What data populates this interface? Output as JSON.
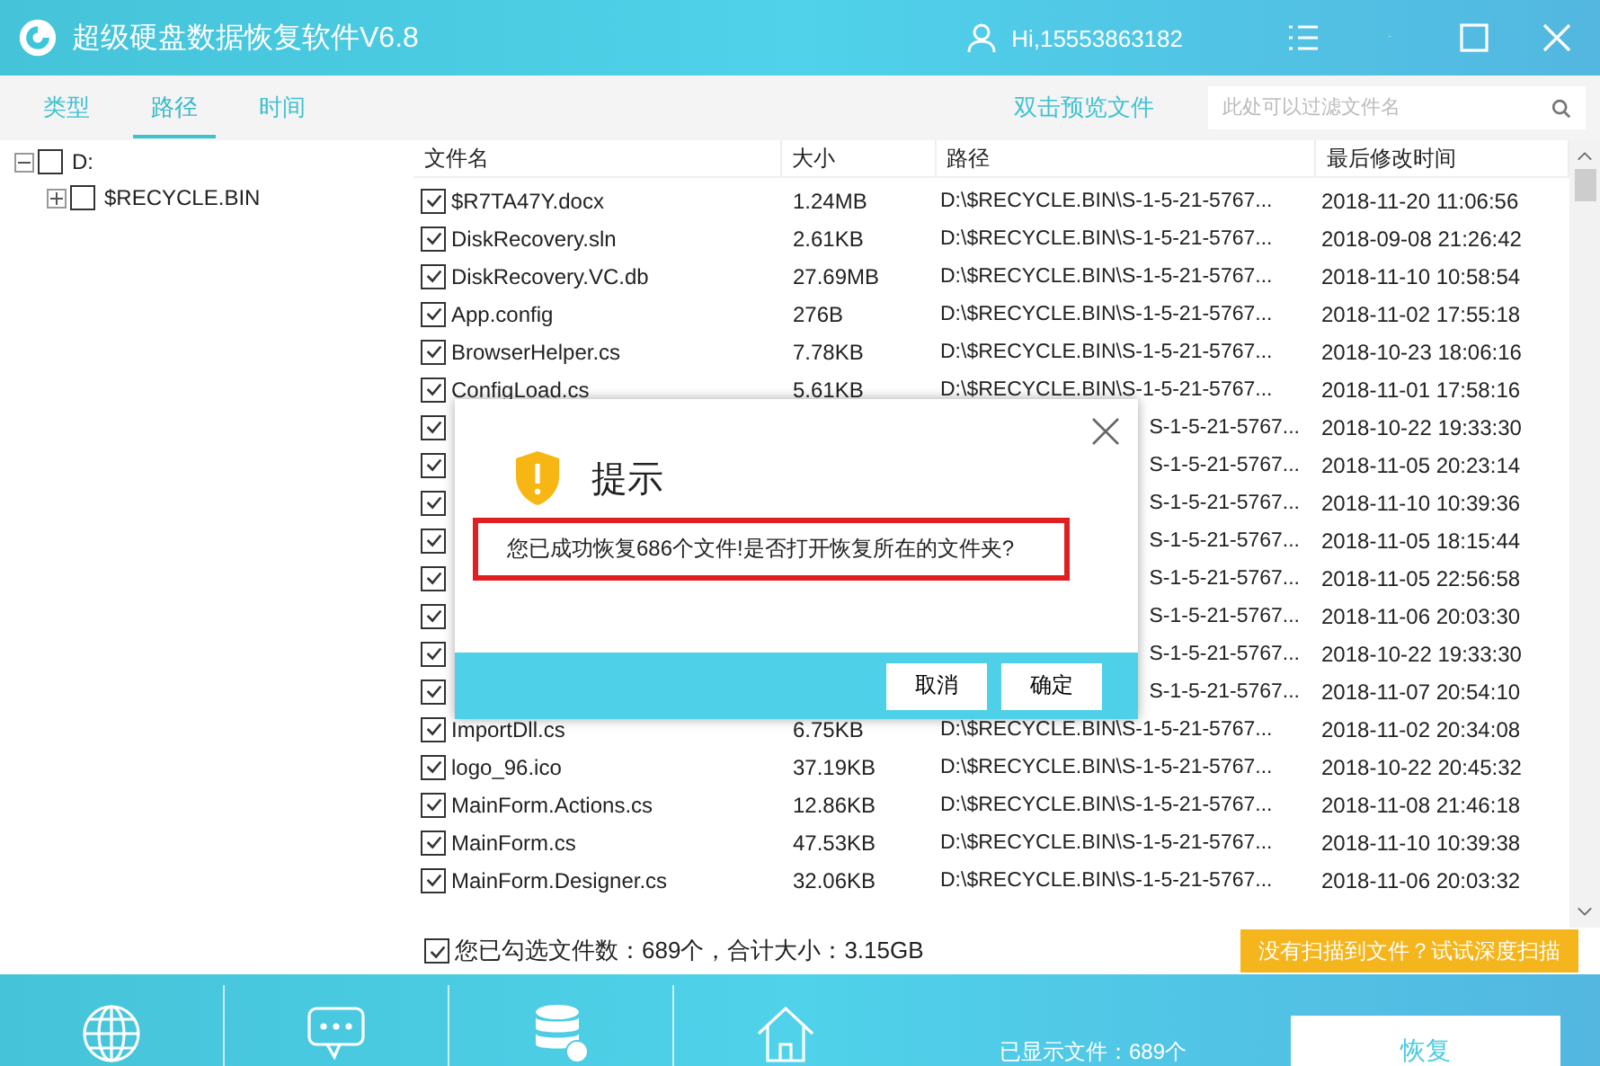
{
  "window": {
    "title": "超级硬盘数据恢复软件V6.8",
    "user": "Hi,15553863182"
  },
  "tabs": [
    {
      "label": "类型",
      "selected": false
    },
    {
      "label": "路径",
      "selected": true
    },
    {
      "label": "时间",
      "selected": false
    }
  ],
  "preview_link": "双击预览文件",
  "search": {
    "placeholder": "此处可以过滤文件名"
  },
  "tree": [
    {
      "label": "D:",
      "checked": false,
      "expanded": true,
      "children": [
        {
          "label": "$RECYCLE.BIN",
          "checked": false,
          "expanded": false
        }
      ]
    }
  ],
  "table": {
    "columns": [
      "文件名",
      "大小",
      "路径",
      "最后修改时间"
    ],
    "rows": [
      {
        "kind": "full",
        "checked": true,
        "name": "$R7TA47Y.docx",
        "size": "1.24MB",
        "path": "D:\\$RECYCLE.BIN\\S-1-5-21-5767...",
        "modified": "2018-11-20 11:06:56"
      },
      {
        "kind": "full",
        "checked": true,
        "name": "DiskRecovery.sln",
        "size": "2.61KB",
        "path": "D:\\$RECYCLE.BIN\\S-1-5-21-5767...",
        "modified": "2018-09-08 21:26:42"
      },
      {
        "kind": "full",
        "checked": true,
        "name": "DiskRecovery.VC.db",
        "size": "27.69MB",
        "path": "D:\\$RECYCLE.BIN\\S-1-5-21-5767...",
        "modified": "2018-11-10 10:58:54"
      },
      {
        "kind": "full",
        "checked": true,
        "name": "App.config",
        "size": "276B",
        "path": "D:\\$RECYCLE.BIN\\S-1-5-21-5767...",
        "modified": "2018-11-02 17:55:18"
      },
      {
        "kind": "full",
        "checked": true,
        "name": "BrowserHelper.cs",
        "size": "7.78KB",
        "path": "D:\\$RECYCLE.BIN\\S-1-5-21-5767...",
        "modified": "2018-10-23 18:06:16"
      },
      {
        "kind": "full",
        "checked": true,
        "name": "ConfigLoad.cs",
        "size": "5.61KB",
        "path": "D:\\$RECYCLE.BIN\\S-1-5-21-5767...",
        "modified": "2018-11-01 17:58:16"
      },
      {
        "kind": "covered",
        "checked": true,
        "path": "S-1-5-21-5767...",
        "modified": "2018-10-22 19:33:30"
      },
      {
        "kind": "covered",
        "checked": true,
        "path": "S-1-5-21-5767...",
        "modified": "2018-11-05 20:23:14"
      },
      {
        "kind": "covered",
        "checked": true,
        "path": "S-1-5-21-5767...",
        "modified": "2018-11-10 10:39:36"
      },
      {
        "kind": "covered",
        "checked": true,
        "path": "S-1-5-21-5767...",
        "modified": "2018-11-05 18:15:44"
      },
      {
        "kind": "covered",
        "checked": true,
        "path": "S-1-5-21-5767...",
        "modified": "2018-11-05 22:56:58"
      },
      {
        "kind": "covered",
        "checked": true,
        "path": "S-1-5-21-5767...",
        "modified": "2018-11-06 20:03:30"
      },
      {
        "kind": "covered",
        "checked": true,
        "path": "S-1-5-21-5767...",
        "modified": "2018-10-22 19:33:30"
      },
      {
        "kind": "covered",
        "checked": true,
        "path": "S-1-5-21-5767...",
        "modified": "2018-11-07 20:54:10"
      },
      {
        "kind": "full",
        "checked": true,
        "name": "ImportDll.cs",
        "size": "6.75KB",
        "path": "D:\\$RECYCLE.BIN\\S-1-5-21-5767...",
        "modified": "2018-11-02 20:34:08"
      },
      {
        "kind": "full",
        "checked": true,
        "name": "logo_96.ico",
        "size": "37.19KB",
        "path": "D:\\$RECYCLE.BIN\\S-1-5-21-5767...",
        "modified": "2018-10-22 20:45:32"
      },
      {
        "kind": "full",
        "checked": true,
        "name": "MainForm.Actions.cs",
        "size": "12.86KB",
        "path": "D:\\$RECYCLE.BIN\\S-1-5-21-5767...",
        "modified": "2018-11-08 21:46:18"
      },
      {
        "kind": "full",
        "checked": true,
        "name": "MainForm.cs",
        "size": "47.53KB",
        "path": "D:\\$RECYCLE.BIN\\S-1-5-21-5767...",
        "modified": "2018-11-10 10:39:38"
      },
      {
        "kind": "full",
        "checked": true,
        "name": "MainForm.Designer.cs",
        "size": "32.06KB",
        "path": "D:\\$RECYCLE.BIN\\S-1-5-21-5767...",
        "modified": "2018-11-06 20:03:32"
      }
    ]
  },
  "selection_summary": {
    "checked": true,
    "text": "您已勾选文件数：689个，合计大小：3.15GB"
  },
  "deep_scan_button": "没有扫描到文件？试试深度扫描",
  "dialog": {
    "title": "提示",
    "message": "您已成功恢复686个文件!是否打开恢复所在的文件夹?",
    "buttons": [
      "取消",
      "确定"
    ]
  },
  "status": "已显示文件：689个",
  "recover_button": "恢复"
}
